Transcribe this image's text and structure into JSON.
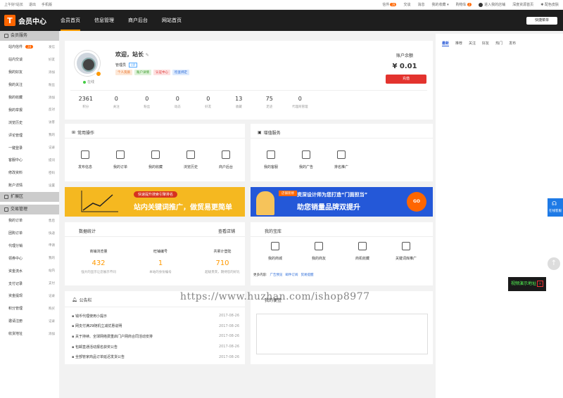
{
  "topbar": {
    "left": [
      "上午好!站长",
      "退出",
      "手机版"
    ],
    "right": [
      {
        "label": "信件",
        "badge": "28"
      },
      {
        "label": "交谈"
      },
      {
        "label": "消息"
      },
      {
        "label": "我的收藏 ▾"
      },
      {
        "label": "购物车",
        "badge": "2"
      },
      {
        "label": "进入我的店铺"
      },
      {
        "label": "深度资源首页"
      },
      {
        "label": "配色皮肤"
      }
    ]
  },
  "header": {
    "logo_mark": "T",
    "title": "会员中心",
    "nav": [
      "会员首页",
      "信息管理",
      "商户后台",
      "网站首页"
    ],
    "quick_menu": "快捷菜单"
  },
  "sidebar": {
    "sections": [
      {
        "title": "会员服务",
        "items": [
          {
            "label": "站内信件",
            "badge": "28",
            "side": "发信"
          },
          {
            "label": "站内交谈",
            "side": "好友"
          },
          {
            "label": "我的好友",
            "side": "添加"
          },
          {
            "label": "我的关注",
            "side": "粉丝"
          },
          {
            "label": "我的收藏",
            "side": "添加"
          },
          {
            "label": "我的举报",
            "side": "反对"
          },
          {
            "label": "浏览历史",
            "side": "访客"
          },
          {
            "label": "评论管理",
            "side": "我的"
          },
          {
            "label": "一键登录",
            "side": "记录"
          },
          {
            "label": "客服中心",
            "side": "提问"
          },
          {
            "label": "修改资料",
            "side": "密码"
          },
          {
            "label": "账户详情",
            "side": "设置"
          }
        ]
      },
      {
        "title": "扩展区",
        "items": []
      },
      {
        "title": "交易管理",
        "items": [
          {
            "label": "我的订单",
            "side": "售后"
          },
          {
            "label": "团购订单",
            "side": "快递"
          },
          {
            "label": "代理分销",
            "side": "申请"
          },
          {
            "label": "领券中心",
            "side": "我的"
          },
          {
            "label": "资金流水",
            "side": "站内"
          },
          {
            "label": "支付记录",
            "side": "支付"
          },
          {
            "label": "资金提现",
            "side": "记录"
          },
          {
            "label": "积分管理",
            "side": "购买"
          },
          {
            "label": "邀请注册",
            "side": "记录"
          },
          {
            "label": "收货地址",
            "side": "添加"
          }
        ]
      }
    ]
  },
  "profile": {
    "welcome": "欢迎，站长",
    "role": "管理员",
    "vip": "VIP",
    "online": "在线",
    "tags": [
      {
        "label": "个人资质",
        "bg": "#fde8d8",
        "fg": "#e66b1f"
      },
      {
        "label": "账户详情",
        "bg": "#dff2da",
        "fg": "#3a9a2a"
      },
      {
        "label": "认证中心",
        "bg": "#fde0e0",
        "fg": "#d33"
      },
      {
        "label": "检查绑定",
        "bg": "#ddeafd",
        "fg": "#2a6ad7"
      }
    ],
    "balance_label": "账户余额",
    "balance_value": "¥ 0.01",
    "recharge": "充值",
    "stats": [
      {
        "n": "2361",
        "l": "积分"
      },
      {
        "n": "0",
        "l": "关注"
      },
      {
        "n": "0",
        "l": "粉丝"
      },
      {
        "n": "0",
        "l": "动态"
      },
      {
        "n": "0",
        "l": "好友"
      },
      {
        "n": "13",
        "l": "收藏"
      },
      {
        "n": "75",
        "l": "足迹"
      },
      {
        "n": "0",
        "l": "代理商管理"
      }
    ]
  },
  "common_ops": {
    "title": "常用操作",
    "items": [
      "发布信息",
      "我的订单",
      "我的收藏",
      "浏览历史",
      "商户后台"
    ]
  },
  "value_services": {
    "title": "增值服务",
    "items": [
      "我的客服",
      "我的广告",
      "排名推广"
    ]
  },
  "banners": {
    "left_pill": "快速提升搜索引擎排名",
    "left_text": "站内关键词推广，做贸易更简单",
    "right_pill": "店铺装修",
    "right_t1": "资深设计师为您打造“门面担当”",
    "right_t2": "助您销量品牌双提升",
    "right_go": "GO"
  },
  "shop_stats": {
    "title": "数据统计",
    "link": "查看店铺",
    "cols": [
      {
        "label": "商铺浏览量",
        "value": "432",
        "sub": "强大的显示让您展示不同"
      },
      {
        "label": "旺铺编号",
        "value": "1",
        "sub": "本站的身份编号"
      },
      {
        "label": "共累计登陆",
        "value": "710",
        "sub": "超级贵宾，期待您的好比"
      }
    ]
  },
  "my_store": {
    "title": "我的宝库",
    "items": [
      "我的商城",
      "我的商友",
      "商机收藏",
      "关键词库推广"
    ],
    "more_label": "更多内容:",
    "more_links": [
      "广告预览",
      "邮件订阅",
      "贸易提醒"
    ]
  },
  "notices": {
    "title": "公告栏",
    "items": [
      {
        "t": "钱币代理使用小提示",
        "d": "2017-08-26"
      },
      {
        "t": "网支付满29随机立减优惠说明",
        "d": "2017-08-26"
      },
      {
        "t": "关于持续、全球网络费重启门户网商合同活动安排",
        "d": "2017-08-26"
      },
      {
        "t": "包邮直通活动报名获奖公告",
        "d": "2017-08-26"
      },
      {
        "t": "全部管家商品订单延迟发货公告",
        "d": "2017-08-26"
      }
    ]
  },
  "memo": {
    "title": "我的便签"
  },
  "right_tabs": [
    "最新",
    "推荐",
    "关注",
    "好友",
    "热门",
    "发布"
  ],
  "float": {
    "online_service": "在线客服",
    "back_top": "↑",
    "video": "视频演示地址",
    "close": "×"
  },
  "watermark": "https://www.huzhan.com/ishop8977",
  "colors": {
    "accent": "#ff6a00",
    "header_bg": "#1e1e1e",
    "balance_btn": "#e3332e"
  }
}
